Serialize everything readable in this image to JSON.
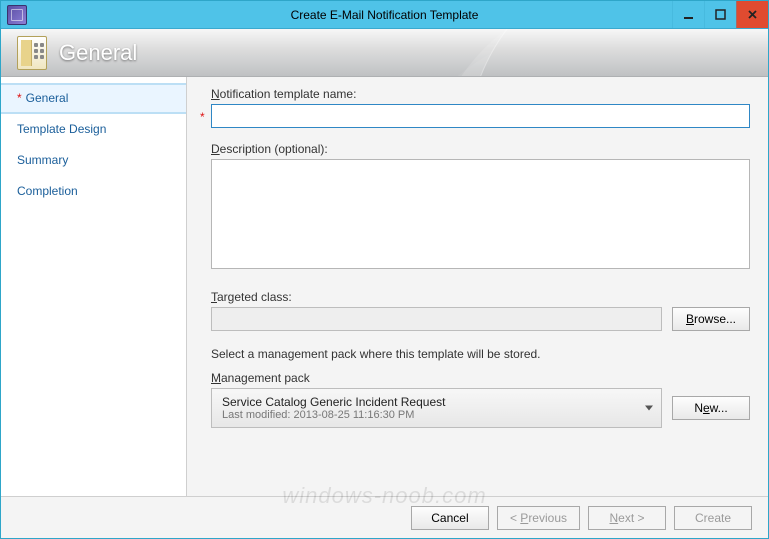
{
  "window": {
    "title": "Create E-Mail Notification Template"
  },
  "banner": {
    "title": "General"
  },
  "sidebar": {
    "steps": [
      {
        "label": "General",
        "required": true,
        "active": true
      },
      {
        "label": "Template Design",
        "required": false,
        "active": false
      },
      {
        "label": "Summary",
        "required": false,
        "active": false
      },
      {
        "label": "Completion",
        "required": false,
        "active": false
      }
    ]
  },
  "form": {
    "name_label_prefix": "N",
    "name_label_rest": "otification template name:",
    "name_value": "",
    "desc_label_prefix": "D",
    "desc_label_rest": "escription (optional):",
    "desc_value": "",
    "targeted_label_prefix": "T",
    "targeted_label_rest": "argeted class:",
    "targeted_value": "",
    "browse_label": "Browse...",
    "mp_instruction": "Select a management pack where this template will be stored.",
    "mp_label_prefix": "M",
    "mp_label_rest": "anagement pack",
    "mp_selected": "Service Catalog Generic Incident Request",
    "mp_sub_label": "Last modified:",
    "mp_sub_value": "2013-08-25 11:16:30 PM",
    "new_label": "New..."
  },
  "footer": {
    "cancel": "Cancel",
    "previous": "< Previous",
    "next": "Next >",
    "create": "Create"
  },
  "watermark": "windows-noob.com"
}
